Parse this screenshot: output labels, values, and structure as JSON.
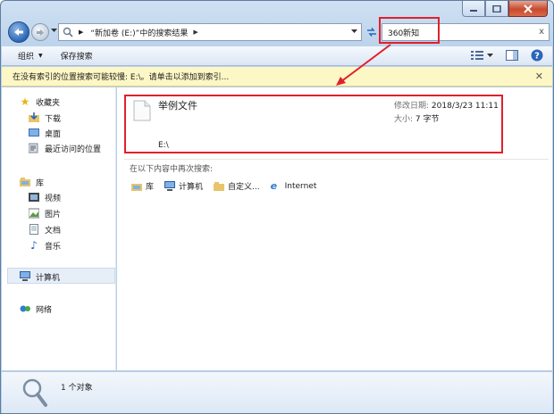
{
  "address": {
    "segments": [
      "“新加卷 (E:)”中的搜索结果"
    ]
  },
  "search": {
    "value": "360新知",
    "clear_icon": "x"
  },
  "toolbar": {
    "organize": "组织",
    "save_search": "保存搜索"
  },
  "info_bar": {
    "text": "在没有索引的位置搜索可能较慢: E:\\。请单击以添加到索引..."
  },
  "nav": {
    "favorites": "收藏夹",
    "favorites_items": [
      "下载",
      "桌面",
      "最近访问的位置"
    ],
    "libraries": "库",
    "library_items": [
      "视频",
      "图片",
      "文档",
      "音乐"
    ],
    "computer": "计算机",
    "network": "网络"
  },
  "result": {
    "name": "举例文件",
    "path": "E:\\",
    "modified_label": "修改日期:",
    "modified_value": "2018/3/23 11:11",
    "size_label": "大小:",
    "size_value": "7 字节"
  },
  "search_again": {
    "label": "在以下内容中再次搜索:",
    "items": [
      "库",
      "计算机",
      "自定义...",
      "Internet"
    ]
  },
  "status": {
    "text": "1 个对象"
  },
  "colors": {
    "highlight": "#e0202c",
    "info_bar": "#fdf7c5",
    "accent": "#2c67b5"
  }
}
